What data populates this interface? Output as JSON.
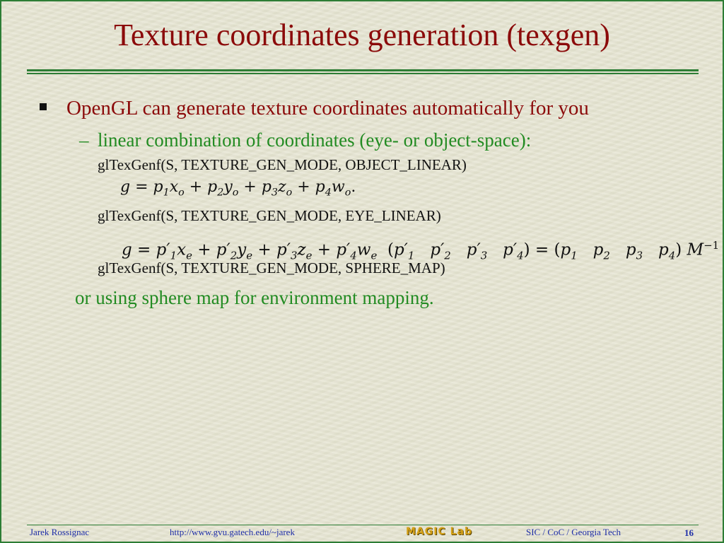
{
  "slide": {
    "title": "Texture coordinates generation (texgen)",
    "bullet1": "OpenGL can generate texture coordinates automatically for you",
    "dash": "–",
    "sub1": "linear combination of coordinates (eye- or object-space):",
    "code1": "glTexGenf(S, TEXTURE_GEN_MODE, OBJECT_LINEAR)",
    "code2": "glTexGenf(S, TEXTURE_GEN_MODE, EYE_LINEAR)",
    "code3": "glTexGenf(S, TEXTURE_GEN_MODE, SPHERE_MAP)",
    "tail": "or using sphere map for environment mapping."
  },
  "footer": {
    "author": "Jarek Rossignac",
    "url": "http://www.gvu.gatech.edu/~jarek",
    "logo_text": "MAGIC Lab",
    "org": "SIC / CoC / Georgia Tech",
    "page": "16"
  },
  "colors": {
    "title": "#8b0a0a",
    "accent_green": "#2d7d35",
    "sub_green": "#228b22",
    "footer_blue": "#1f2ea8",
    "background": "#e7e6d3"
  }
}
